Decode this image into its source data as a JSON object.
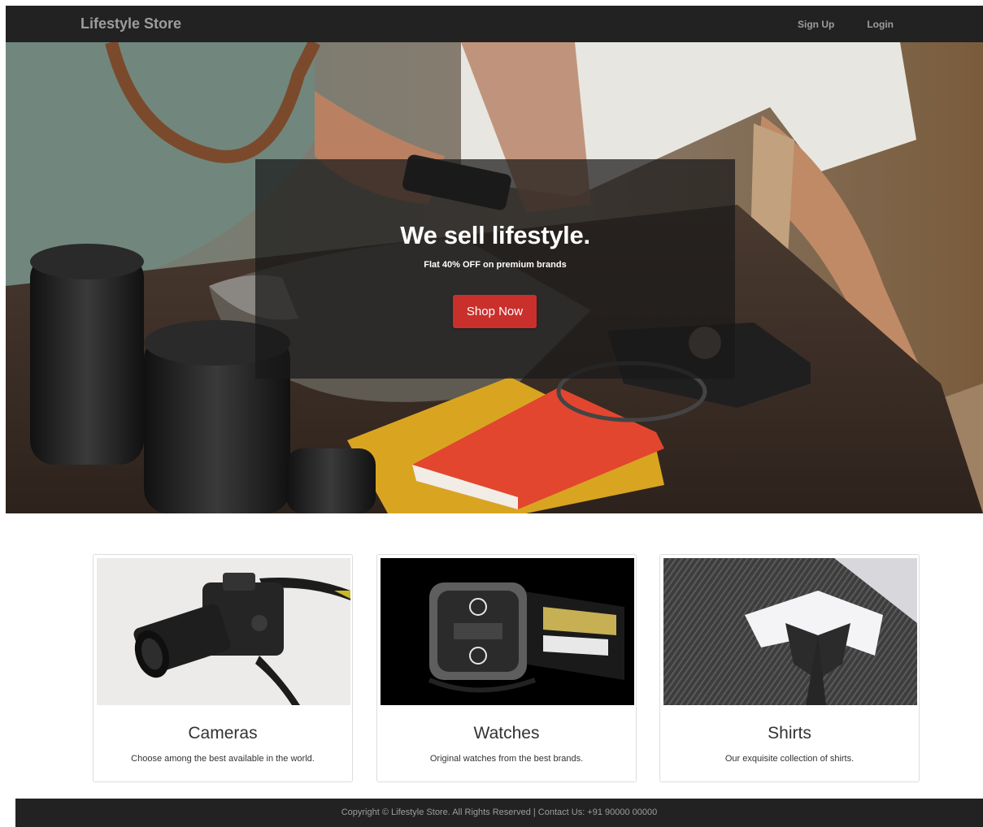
{
  "navbar": {
    "brand": "Lifestyle Store",
    "links": [
      {
        "label": "Sign Up"
      },
      {
        "label": "Login"
      }
    ]
  },
  "hero": {
    "title": "We sell lifestyle.",
    "subtitle": "Flat 40% OFF on premium brands",
    "button_label": "Shop Now"
  },
  "products": [
    {
      "title": "Cameras",
      "description": "Choose among the best available in the world."
    },
    {
      "title": "Watches",
      "description": "Original watches from the best brands."
    },
    {
      "title": "Shirts",
      "description": "Our exquisite collection of shirts."
    }
  ],
  "footer": {
    "text": "Copyright © Lifestyle Store. All Rights Reserved | Contact Us: +91 90000 00000"
  },
  "colors": {
    "navbar_bg": "#222222",
    "nav_text": "#9d9d9d",
    "button_bg": "#c9302c",
    "banner_overlay": "rgba(25,25,25,0.72)"
  }
}
